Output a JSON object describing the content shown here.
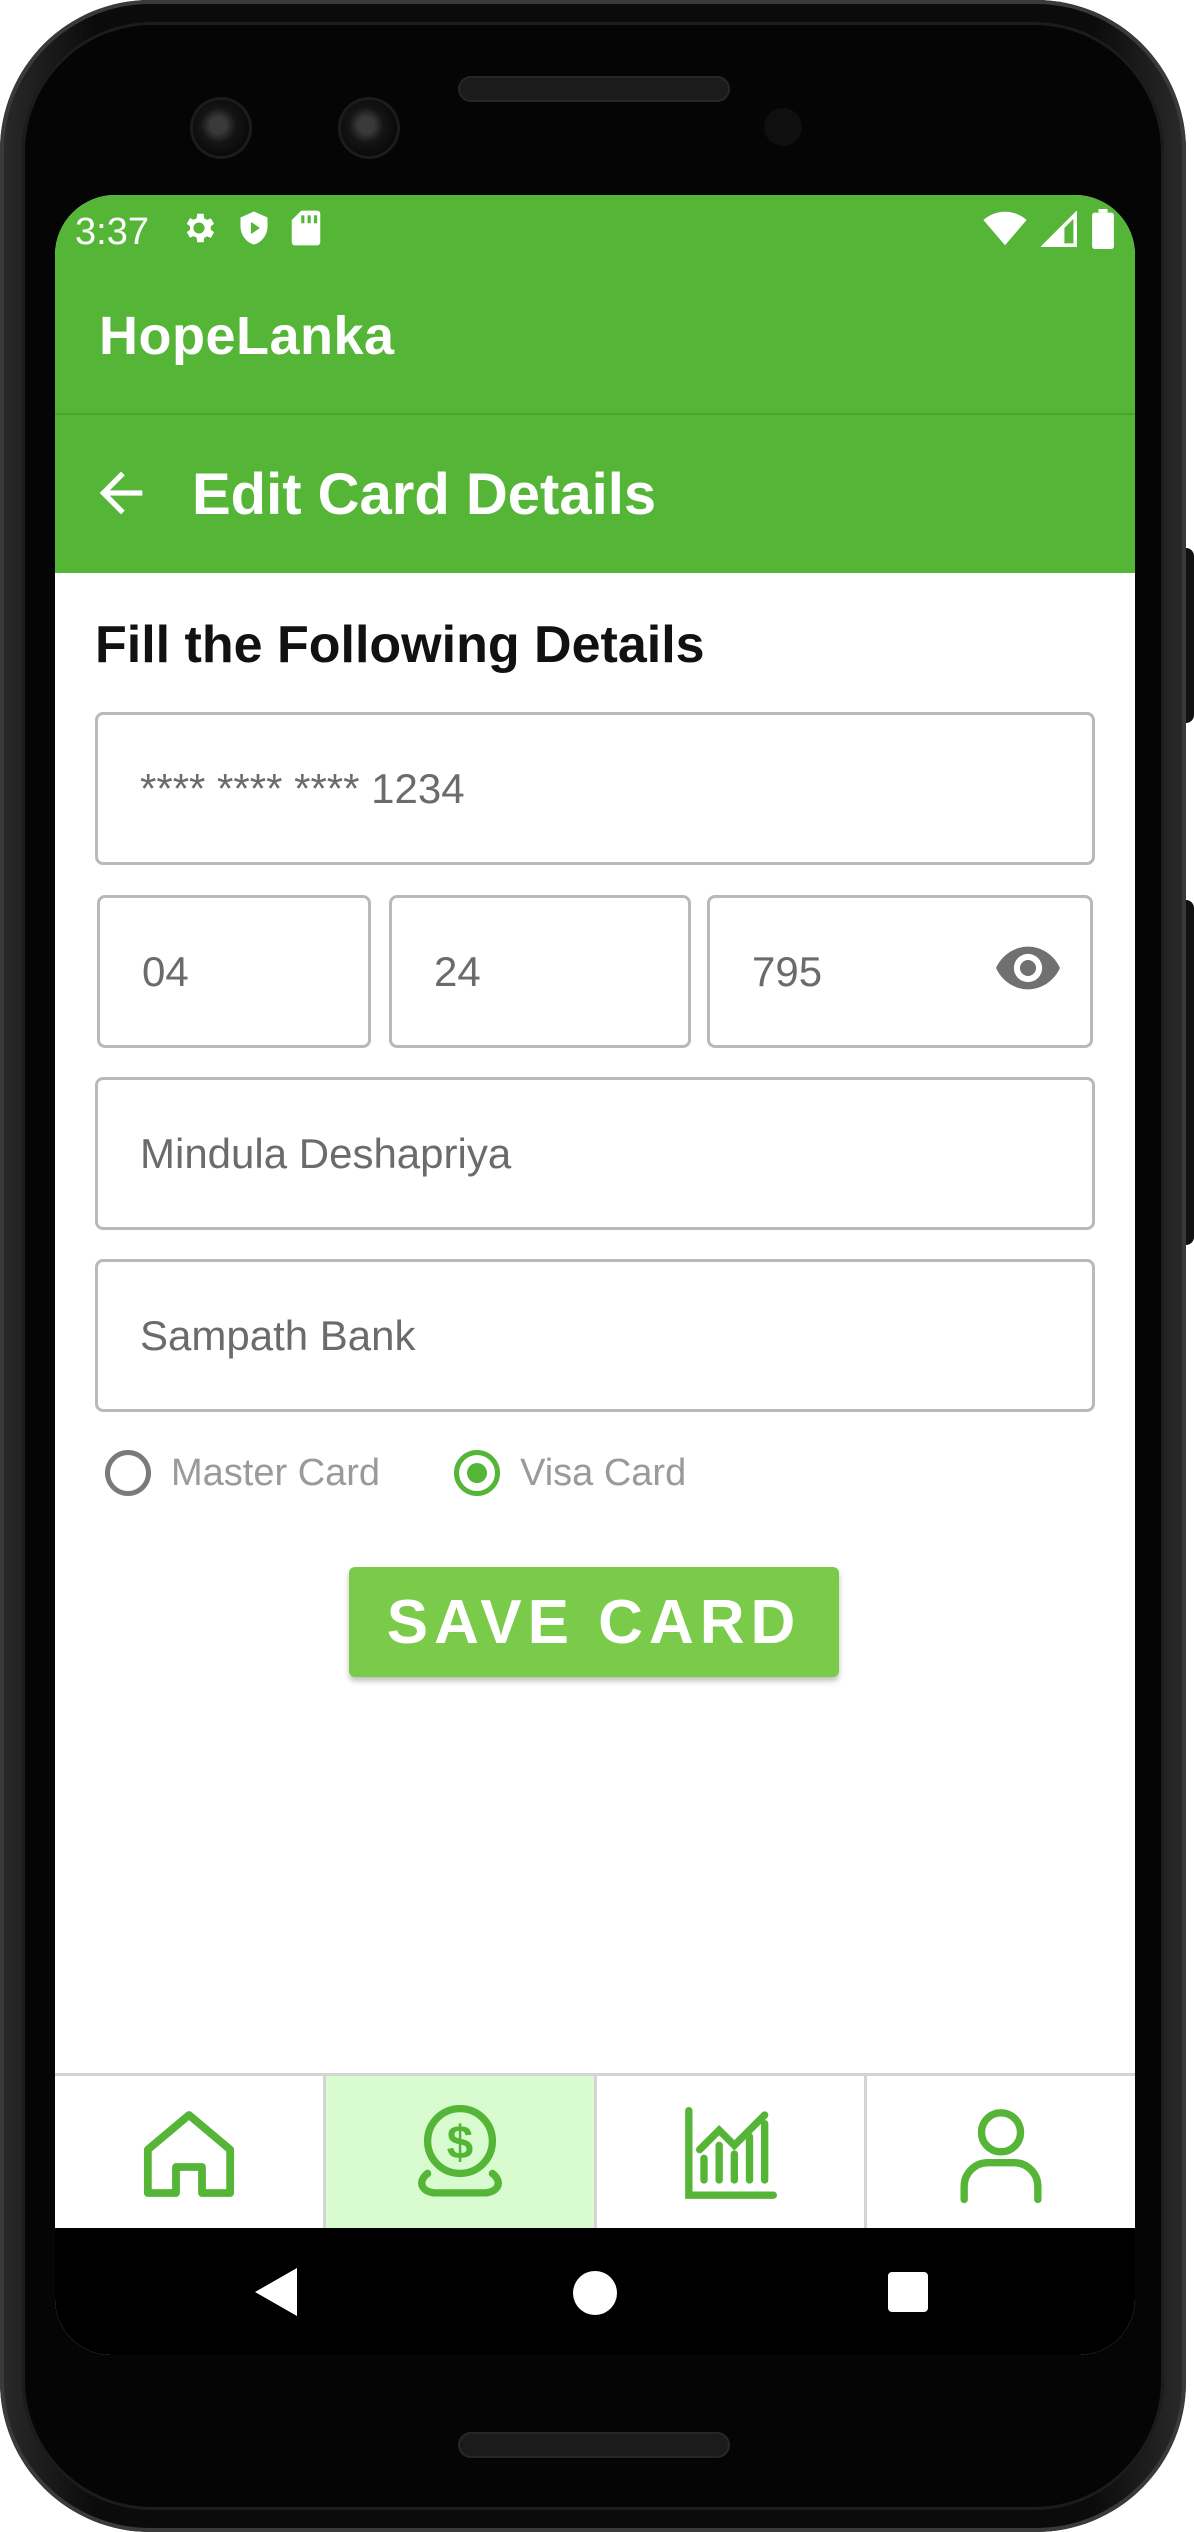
{
  "status_bar": {
    "time": "3:37",
    "left_icons": [
      "gear-icon",
      "shield-icon",
      "sd-card-icon"
    ],
    "right_icons": [
      "wifi-icon",
      "signal-icon",
      "battery-icon"
    ]
  },
  "app_bar": {
    "title": "HopeLanka"
  },
  "header": {
    "title": "Edit Card Details",
    "back_icon": "arrow-left-icon"
  },
  "form": {
    "section_title": "Fill the Following Details",
    "card_number": "**** **** **** 1234",
    "expiry_month": "04",
    "expiry_year": "24",
    "cvv": "795",
    "cardholder_name": "Mindula Deshapriya",
    "bank_name": "Sampath Bank",
    "card_types": [
      {
        "label": "Master Card",
        "selected": false
      },
      {
        "label": "Visa Card",
        "selected": true
      }
    ],
    "save_label": "SAVE CARD"
  },
  "bottom_nav": {
    "items": [
      {
        "icon": "home-icon",
        "active": false
      },
      {
        "icon": "coin-payment-icon",
        "active": true
      },
      {
        "icon": "chart-icon",
        "active": false
      },
      {
        "icon": "user-icon",
        "active": false
      }
    ]
  },
  "colors": {
    "primary": "#55b536",
    "button": "#7bcb4b",
    "active_nav_bg": "#d8fbcf"
  }
}
